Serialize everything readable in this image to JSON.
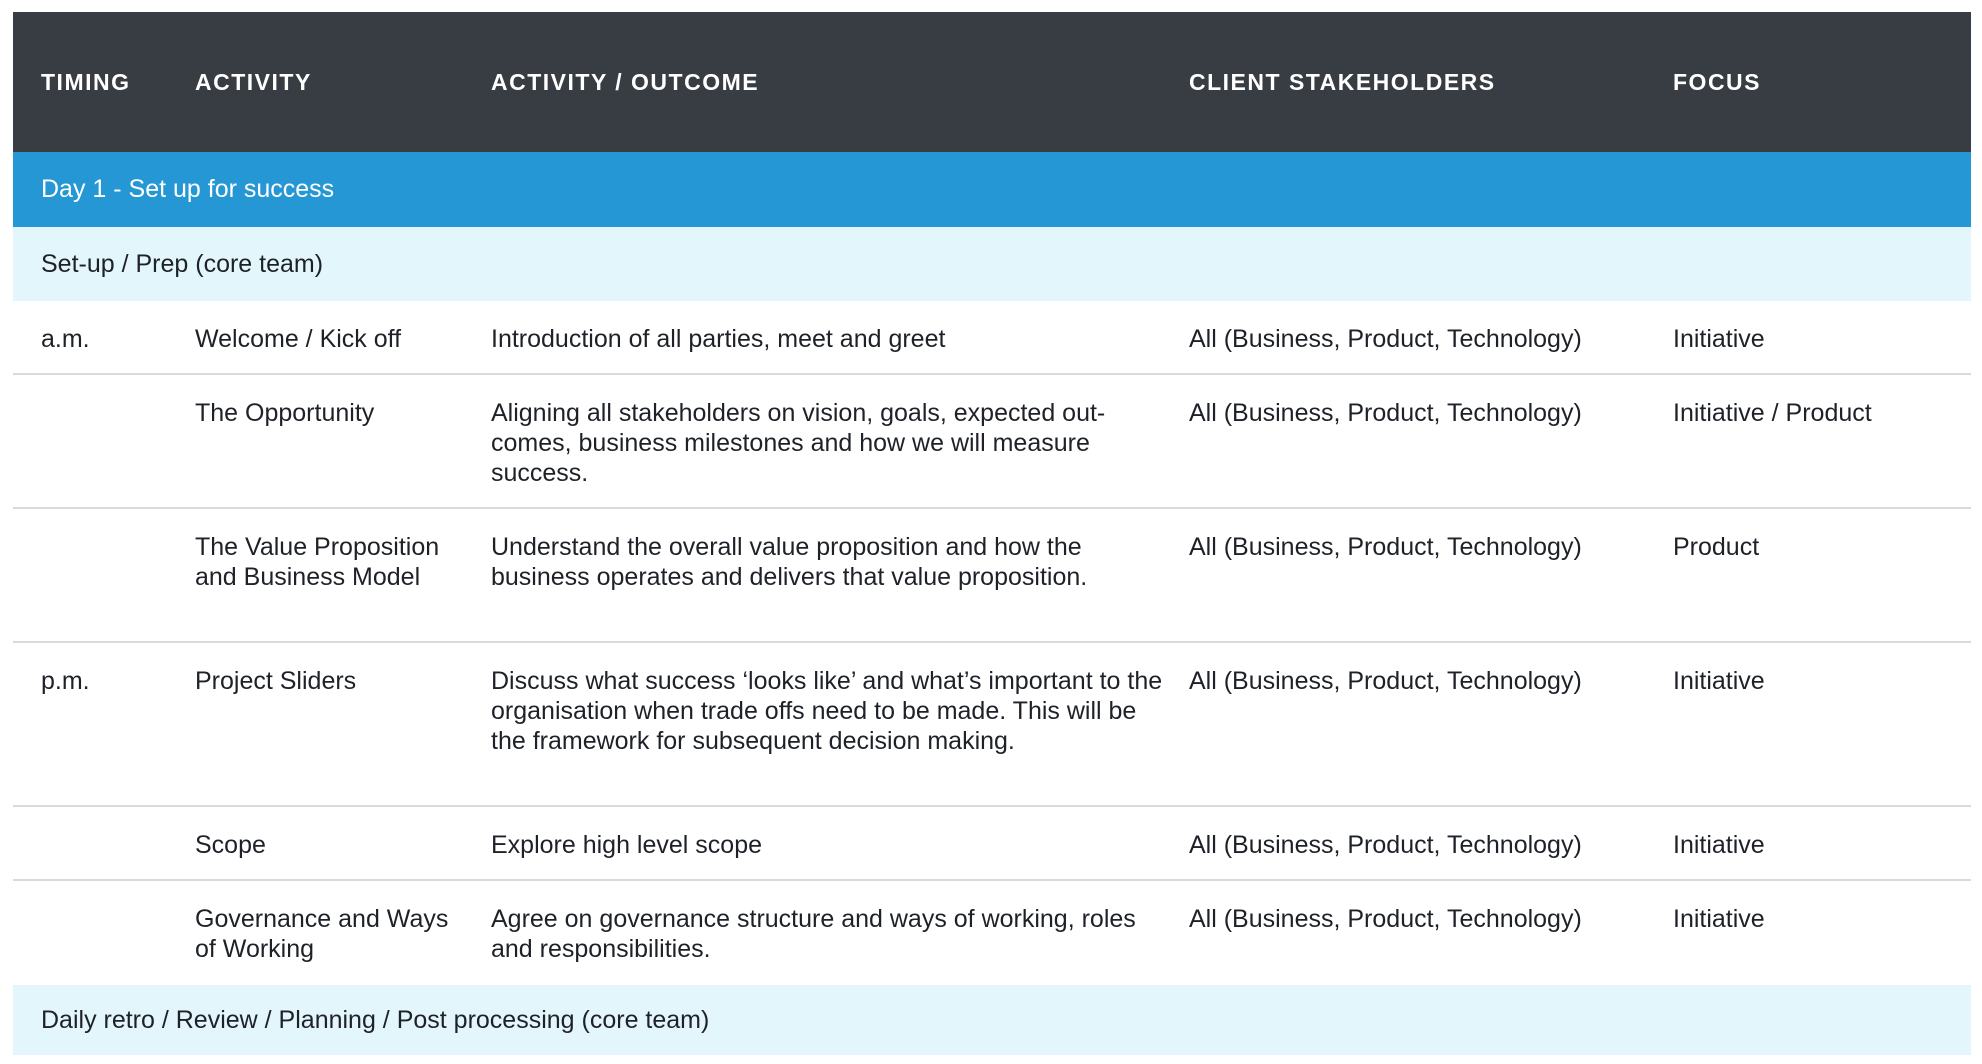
{
  "header": {
    "timing": "TIMING",
    "activity": "ACTIVITY",
    "outcome": "ACTIVITY / OUTCOME",
    "stakeholders": "CLIENT STAKEHOLDERS",
    "focus": "FOCUS"
  },
  "day_title": "Day 1 - Set up for success",
  "prep_title": "Set-up / Prep (core team)",
  "rows": [
    {
      "timing": "a.m.",
      "activity": "Welcome / Kick off",
      "outcome": "Introduction of all parties, meet and greet",
      "stakeholders": "All (Business, Product, Technology)",
      "focus": "Initiative"
    },
    {
      "timing": "",
      "activity": "The Opportunity",
      "outcome": "Aligning all stakeholders on vision, goals, expected out-comes, business milestones and how we will measure success.",
      "stakeholders": "All (Business, Product, Technology)",
      "focus": "Initiative / Product"
    },
    {
      "timing": "",
      "activity": "The Value Proposition and Business Model",
      "outcome": "Understand the overall value proposition and how the business operates and delivers that value proposition.",
      "stakeholders": "All (Business, Product, Technology)",
      "focus": "Product"
    },
    {
      "timing": "p.m.",
      "activity": "Project Sliders",
      "outcome": "Discuss what success ‘looks like’ and what’s important to the organisation when trade offs need to be made. This will be the framework for subsequent decision making.",
      "stakeholders": "All (Business, Product, Technology)",
      "focus": "Initiative"
    },
    {
      "timing": "",
      "activity": "Scope",
      "outcome": "Explore high level scope",
      "stakeholders": "All (Business, Product, Technology)",
      "focus": "Initiative"
    },
    {
      "timing": "",
      "activity": "Governance and Ways of Working",
      "outcome": "Agree on governance structure and ways of working, roles and responsibilities.",
      "stakeholders": "All (Business, Product, Technology)",
      "focus": "Initiative"
    }
  ],
  "retro_title": "Daily retro / Review / Planning / Post processing (core team)"
}
